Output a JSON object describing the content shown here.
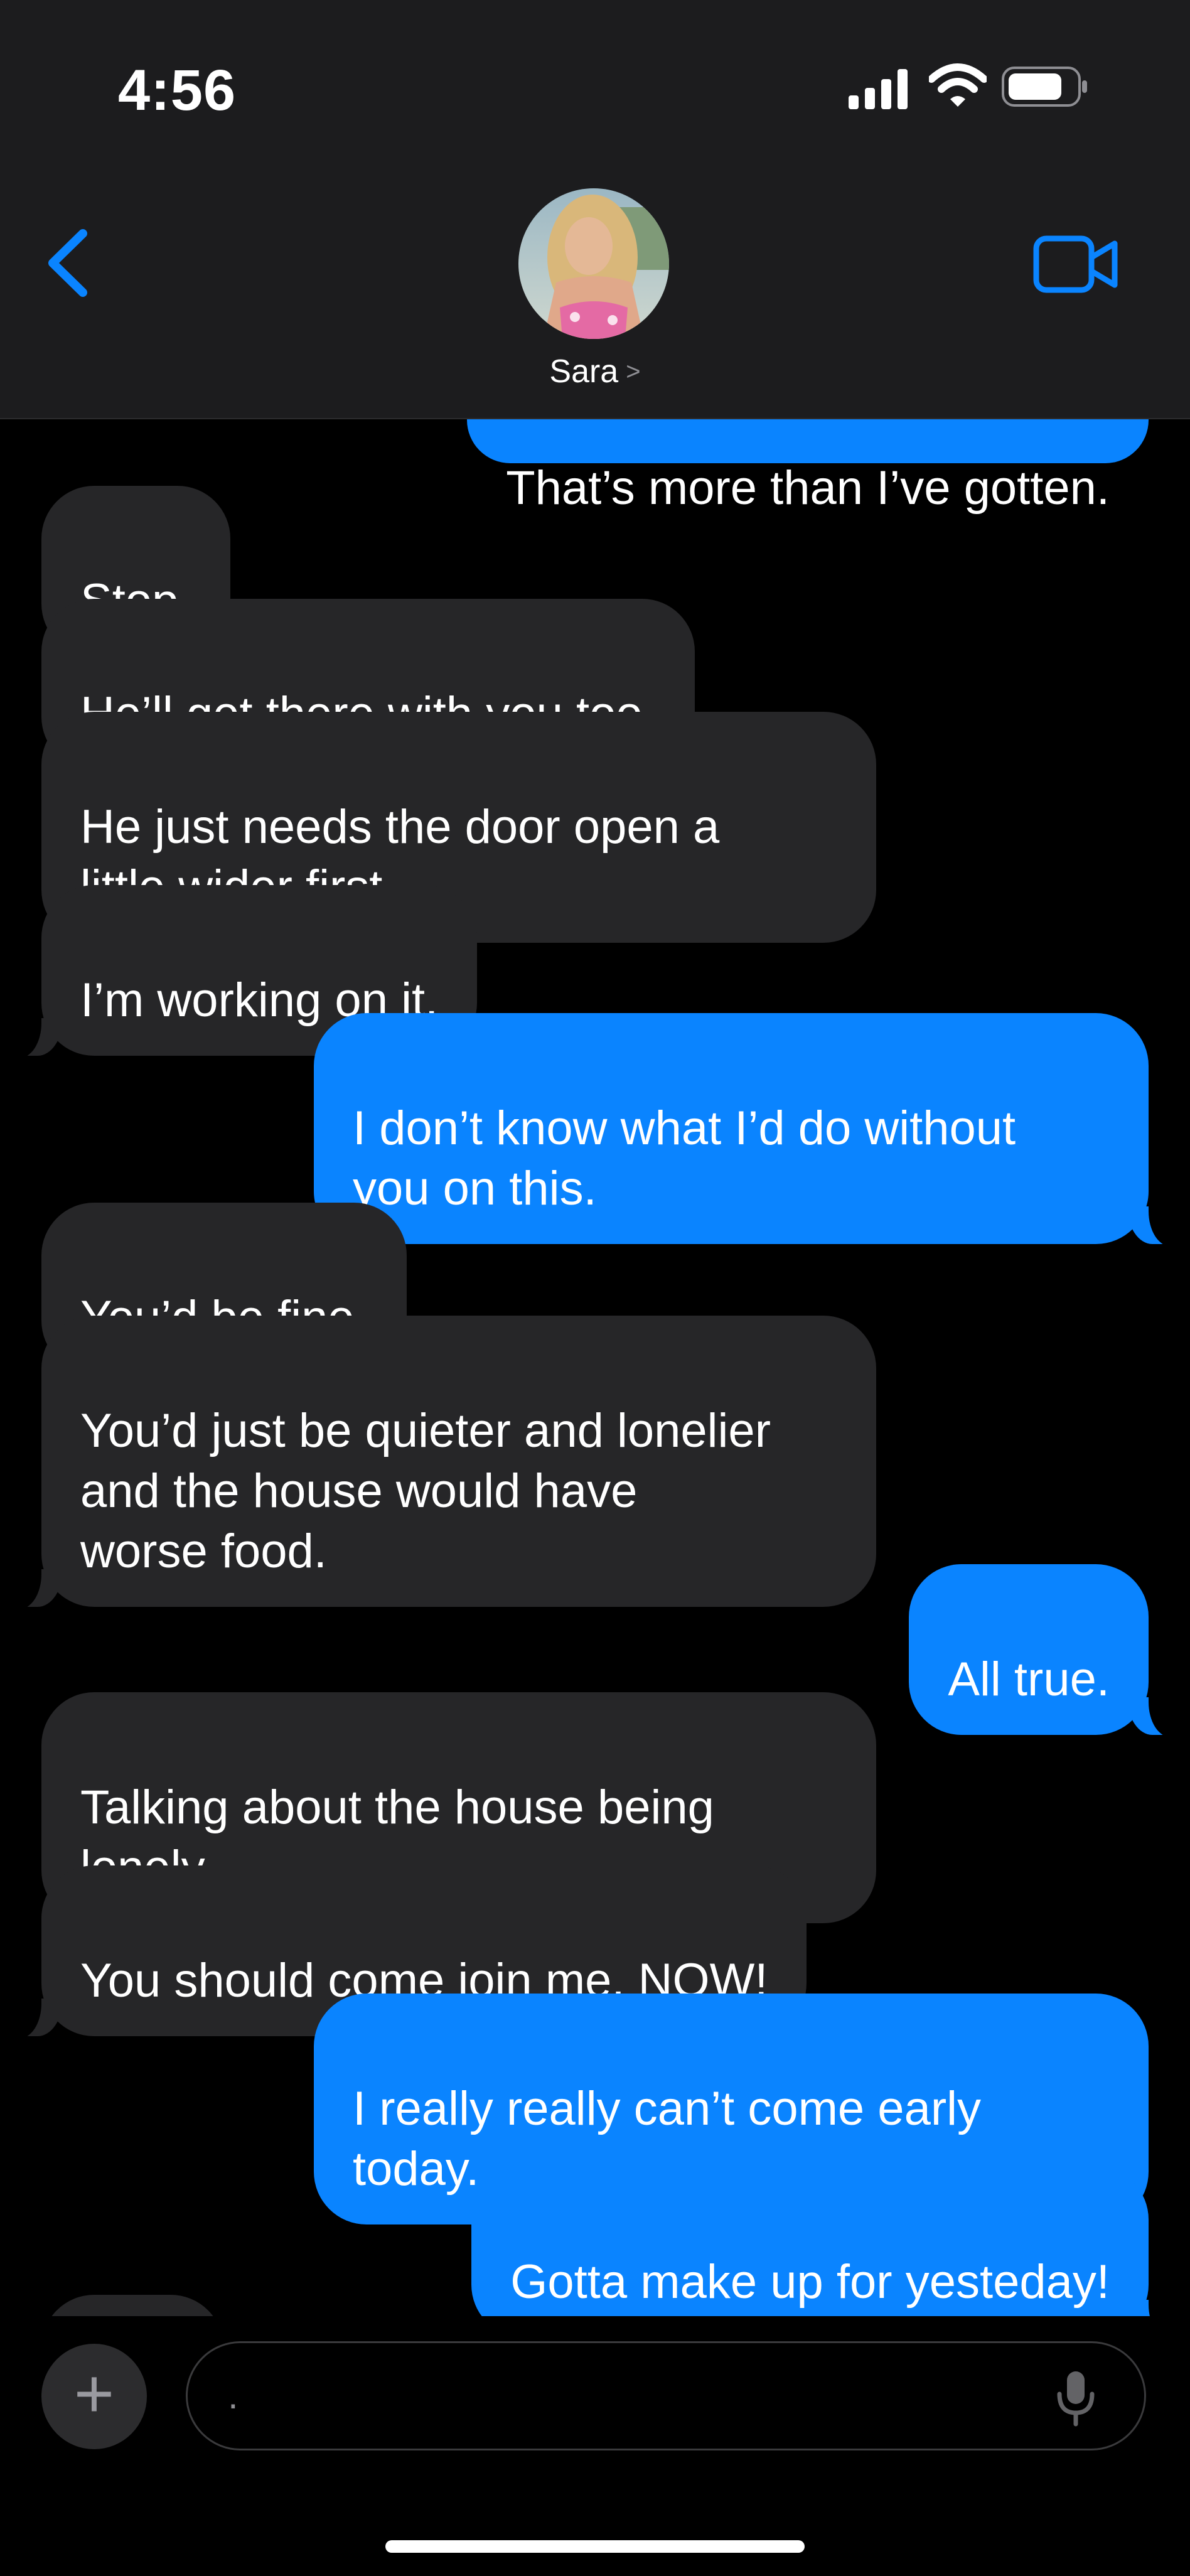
{
  "status_bar": {
    "time": "4:56",
    "icons": [
      "cellular-signal-icon",
      "wifi-icon",
      "battery-icon"
    ]
  },
  "header": {
    "back_icon": "chevron-left-icon",
    "contact_name": "Sara",
    "contact_chevron": ">",
    "video_icon": "video-camera-icon"
  },
  "messages": [
    {
      "from": "me",
      "text": "That’s more than I’ve gotten."
    },
    {
      "from": "them",
      "text": "Stop."
    },
    {
      "from": "them",
      "text": "He’ll get there with you too."
    },
    {
      "from": "them",
      "text": "He just needs the door open a\nlittle wider first."
    },
    {
      "from": "them",
      "text": "I’m working on it."
    },
    {
      "from": "me",
      "text": "I don’t know what I’d do without\nyou on this."
    },
    {
      "from": "them",
      "text": "You’d be fine."
    },
    {
      "from": "them",
      "text": "You’d just be quieter and lonelier\nand the house would have\nworse food."
    },
    {
      "from": "me",
      "text": "All true."
    },
    {
      "from": "them",
      "text": "Talking about the house being\nlonely."
    },
    {
      "from": "them",
      "text": "You should come join me, NOW!"
    },
    {
      "from": "me",
      "text": "I really really can’t come early\ntoday."
    },
    {
      "from": "me",
      "text": "Gotta make up for yesteday!"
    }
  ],
  "composer": {
    "plus_label": "+",
    "input_value": ".",
    "mic_icon": "microphone-icon"
  },
  "colors": {
    "outgoing_bubble": "#0a84ff",
    "incoming_bubble": "#262628",
    "accent": "#0a84ff",
    "background": "#000000"
  }
}
